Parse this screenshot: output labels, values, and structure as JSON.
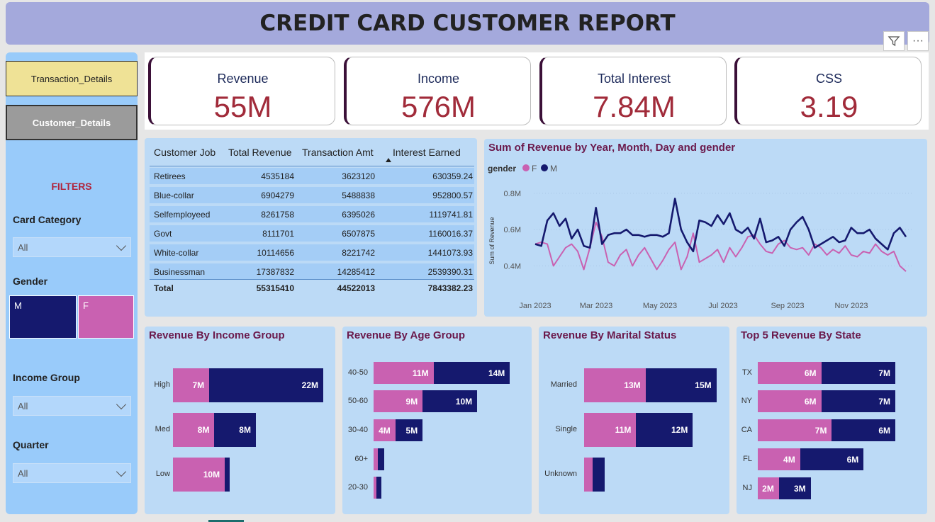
{
  "report": {
    "title": "CREDIT CARD CUSTOMER REPORT"
  },
  "toolbar": {
    "filter_icon": "funnel-icon",
    "more_icon": "ellipsis-icon",
    "more_label": "···"
  },
  "sidebar": {
    "nav": {
      "transaction_label": "Transaction_Details",
      "customer_label": "Customer_Details"
    },
    "filters_title": "FILTERS",
    "card_category": {
      "label": "Card Category",
      "value": "All"
    },
    "gender": {
      "label": "Gender",
      "m": "M",
      "f": "F"
    },
    "income_group": {
      "label": "Income Group",
      "value": "All"
    },
    "quarter": {
      "label": "Quarter",
      "value": "All"
    }
  },
  "kpis": [
    {
      "label": "Revenue",
      "value": "55M"
    },
    {
      "label": "Income",
      "value": "576M"
    },
    {
      "label": "Total Interest",
      "value": "7.84M"
    },
    {
      "label": "CSS",
      "value": "3.19"
    }
  ],
  "table": {
    "headers": [
      "Customer Job",
      "Total Revenue",
      "Transaction Amt",
      "Interest Earned"
    ],
    "rows": [
      [
        "Retirees",
        "4535184",
        "3623120",
        "630359.24"
      ],
      [
        "Blue-collar",
        "6904279",
        "5488838",
        "952800.57"
      ],
      [
        "Selfemployeed",
        "8261758",
        "6395026",
        "1119741.81"
      ],
      [
        "Govt",
        "8111701",
        "6507875",
        "1160016.37"
      ],
      [
        "White-collar",
        "10114656",
        "8221742",
        "1441073.93"
      ],
      [
        "Businessman",
        "17387832",
        "14285412",
        "2539390.31"
      ]
    ],
    "total": [
      "Total",
      "55315410",
      "44522013",
      "7843382.23"
    ]
  },
  "colors": {
    "female": "#c961b1",
    "male": "#15196e"
  },
  "line_chart": {
    "title": "Sum of Revenue by Year, Month, Day and gender",
    "legend_title": "gender",
    "legend_f": "F",
    "legend_m": "M",
    "ylabel": "Sum of Revenue",
    "yticks": [
      "0.8M",
      "0.6M",
      "0.4M"
    ],
    "xticks": [
      "Jan 2023",
      "Mar 2023",
      "May 2023",
      "Jul 2023",
      "Sep 2023",
      "Nov 2023"
    ]
  },
  "bar_panels": {
    "income": {
      "title": "Revenue By Income Group"
    },
    "age": {
      "title": "Revenue By Age Group"
    },
    "marital": {
      "title": "Revenue By Marital Status"
    },
    "state": {
      "title": "Top 5 Revenue By State"
    }
  },
  "chart_data": [
    {
      "type": "line",
      "title": "Sum of Revenue by Year, Month, Day and gender",
      "ylabel": "Sum of Revenue",
      "ylim": [
        0.3,
        0.85
      ],
      "x_range": [
        "Jan 2023",
        "Dec 2023"
      ],
      "series": [
        {
          "name": "F",
          "values": [
            0.52,
            0.53,
            0.52,
            0.4,
            0.45,
            0.5,
            0.52,
            0.48,
            0.38,
            0.5,
            0.64,
            0.56,
            0.42,
            0.4,
            0.46,
            0.49,
            0.4,
            0.46,
            0.5,
            0.44,
            0.38,
            0.43,
            0.49,
            0.53,
            0.38,
            0.45,
            0.58,
            0.42,
            0.44,
            0.46,
            0.49,
            0.42,
            0.5,
            0.45,
            0.5,
            0.56,
            0.57,
            0.52,
            0.48,
            0.47,
            0.52,
            0.54,
            0.5,
            0.49,
            0.5,
            0.46,
            0.52,
            0.5,
            0.46,
            0.49,
            0.47,
            0.51,
            0.46,
            0.45,
            0.48,
            0.47,
            0.52,
            0.48,
            0.46,
            0.48,
            0.4,
            0.37
          ]
        },
        {
          "name": "M",
          "values": [
            0.52,
            0.51,
            0.65,
            0.69,
            0.62,
            0.66,
            0.55,
            0.6,
            0.51,
            0.5,
            0.72,
            0.52,
            0.57,
            0.58,
            0.58,
            0.6,
            0.57,
            0.57,
            0.56,
            0.57,
            0.57,
            0.56,
            0.58,
            0.77,
            0.6,
            0.53,
            0.48,
            0.65,
            0.64,
            0.62,
            0.68,
            0.63,
            0.69,
            0.6,
            0.58,
            0.61,
            0.55,
            0.66,
            0.53,
            0.54,
            0.56,
            0.51,
            0.6,
            0.64,
            0.67,
            0.6,
            0.5,
            0.52,
            0.54,
            0.56,
            0.53,
            0.54,
            0.61,
            0.58,
            0.58,
            0.6,
            0.55,
            0.52,
            0.49,
            0.58,
            0.61,
            0.56
          ]
        }
      ]
    },
    {
      "type": "bar",
      "title": "Revenue By Income Group",
      "categories": [
        "High",
        "Med",
        "Low"
      ],
      "series": [
        {
          "name": "F",
          "values": [
            7,
            8,
            10
          ],
          "labels": [
            "7M",
            "8M",
            "10M"
          ]
        },
        {
          "name": "M",
          "values": [
            22,
            8,
            0.2
          ],
          "labels": [
            "22M",
            "8M",
            ""
          ]
        }
      ]
    },
    {
      "type": "bar",
      "title": "Revenue By Age Group",
      "categories": [
        "40-50",
        "50-60",
        "30-40",
        "60+",
        "20-30"
      ],
      "series": [
        {
          "name": "F",
          "values": [
            11,
            9,
            4,
            0.8,
            0.5
          ],
          "labels": [
            "11M",
            "9M",
            "4M",
            "",
            ""
          ]
        },
        {
          "name": "M",
          "values": [
            14,
            10,
            5,
            1.2,
            0.5
          ],
          "labels": [
            "14M",
            "10M",
            "5M",
            "",
            ""
          ]
        }
      ]
    },
    {
      "type": "bar",
      "title": "Revenue By Marital Status",
      "categories": [
        "Married",
        "Single",
        "Unknown"
      ],
      "series": [
        {
          "name": "F",
          "values": [
            13,
            11,
            1.8
          ],
          "labels": [
            "13M",
            "11M",
            ""
          ]
        },
        {
          "name": "M",
          "values": [
            15,
            12,
            2.5
          ],
          "labels": [
            "15M",
            "12M",
            ""
          ]
        }
      ]
    },
    {
      "type": "bar",
      "title": "Top 5 Revenue By State",
      "categories": [
        "TX",
        "NY",
        "CA",
        "FL",
        "NJ"
      ],
      "series": [
        {
          "name": "F",
          "values": [
            6,
            6,
            7,
            4,
            2
          ],
          "labels": [
            "6M",
            "6M",
            "7M",
            "4M",
            "2M"
          ]
        },
        {
          "name": "M",
          "values": [
            7,
            7,
            6,
            6,
            3
          ],
          "labels": [
            "7M",
            "7M",
            "6M",
            "6M",
            "3M"
          ]
        }
      ]
    }
  ]
}
